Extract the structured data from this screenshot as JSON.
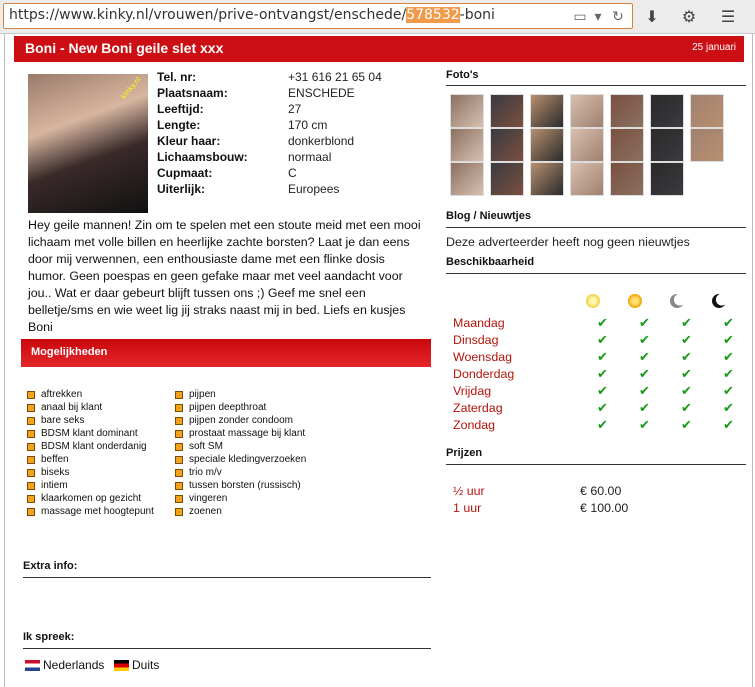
{
  "browser": {
    "url_prefix": "https://www.kinky.nl/vrouwen/prive-ontvangst/enschede/",
    "url_highlight": "578532",
    "url_suffix": "-boni"
  },
  "header": {
    "title": "Boni - New Boni geile slet xxx",
    "date": "25 januari"
  },
  "photo": {
    "watermark": "kinky.nl"
  },
  "specs": [
    {
      "label": "Tel. nr:",
      "value": "+31 616 21 65 04"
    },
    {
      "label": "Plaatsnaam:",
      "value": "ENSCHEDE"
    },
    {
      "label": "Leeftijd:",
      "value": "27"
    },
    {
      "label": "Lengte:",
      "value": "170 cm"
    },
    {
      "label": "Kleur haar:",
      "value": "donkerblond"
    },
    {
      "label": "Lichaamsbouw:",
      "value": "normaal"
    },
    {
      "label": "Cupmaat:",
      "value": "C"
    },
    {
      "label": "Uiterlijk:",
      "value": "Europees"
    }
  ],
  "bio": "Hey geile mannen! Zin om te spelen met een stoute meid met een mooi lichaam met volle billen en heerlijke zachte borsten? Laat je dan eens door mij verwennen, een enthousiaste dame met een flinke dosis humor. Geen poespas en geen gefake maar met veel aandacht voor jou.. Wat er daar gebeurt blijft tussen ons ;) Geef me snel een belletje/sms en wie weet lig jij straks naast mij in bed. Liefs en kusjes Boni",
  "mogelijkheden": {
    "title": "Mogelijkheden",
    "col1": [
      "aftrekken",
      "anaal bij klant",
      "bare seks",
      "BDSM klant dominant",
      "BDSM klant onderdanig",
      "beffen",
      "biseks",
      "intiem",
      "klaarkomen op gezicht",
      "massage met hoogtepunt"
    ],
    "col2": [
      "pijpen",
      "pijpen deepthroat",
      "pijpen zonder condoom",
      "prostaat massage bij klant",
      "soft SM",
      "speciale kledingverzoeken",
      "trio m/v",
      "tussen borsten (russisch)",
      "vingeren",
      "zoenen"
    ]
  },
  "extra_info": {
    "title": "Extra info:"
  },
  "languages": {
    "title": "Ik spreek:",
    "items": [
      "Nederlands",
      "Duits"
    ]
  },
  "fotos": {
    "title": "Foto's",
    "count": 20
  },
  "blog": {
    "title": "Blog / Nieuwtjes",
    "text": "Deze adverteerder heeft nog geen nieuwtjes"
  },
  "beschikbaarheid": {
    "title": "Beschikbaarheid",
    "slots": [
      "morning-icon",
      "afternoon-icon",
      "evening-icon",
      "night-icon"
    ],
    "days": [
      "Maandag",
      "Dinsdag",
      "Woensdag",
      "Donderdag",
      "Vrijdag",
      "Zaterdag",
      "Zondag"
    ],
    "check": "✔"
  },
  "prijzen": {
    "title": "Prijzen",
    "items": [
      {
        "duration": "½   uur",
        "price": "€ 60.00"
      },
      {
        "duration": "1   uur",
        "price": "€ 100.00"
      }
    ]
  },
  "colors": {
    "accent": "#cc0f14",
    "day_text": "#b3150c",
    "check": "#179a17",
    "bullet": "#f3a21b"
  }
}
